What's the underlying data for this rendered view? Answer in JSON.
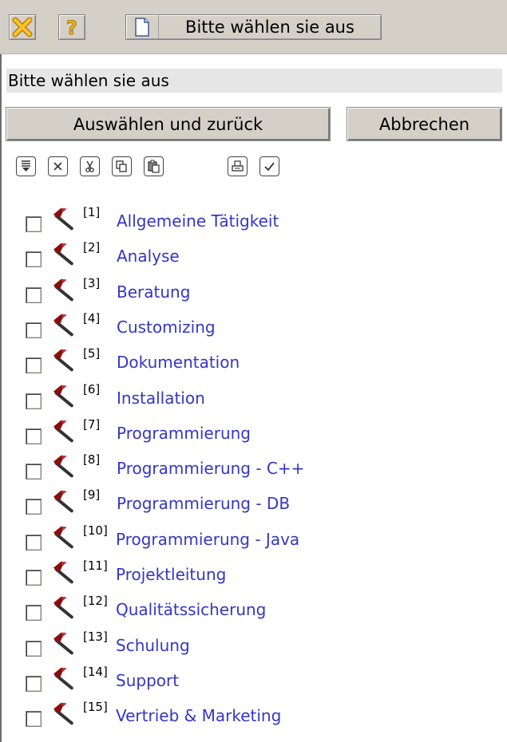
{
  "toolbar": {
    "close_icon": "close-x-icon",
    "help_icon": "question-mark-icon",
    "doc_icon": "document-icon",
    "doc_button_label": "Bitte wählen sie aus"
  },
  "title": "Bitte wählen sie aus",
  "buttons": {
    "select_label": "Auswählen und zurück",
    "cancel_label": "Abbrechen"
  },
  "iconbar": [
    "expand-list-icon",
    "delete-icon",
    "cut-icon",
    "copy-icon",
    "paste-icon",
    "print-icon",
    "check-icon"
  ],
  "list": [
    {
      "num": "[1]",
      "label": "Allgemeine Tätigkeit"
    },
    {
      "num": "[2]",
      "label": "Analyse"
    },
    {
      "num": "[3]",
      "label": "Beratung"
    },
    {
      "num": "[4]",
      "label": "Customizing"
    },
    {
      "num": "[5]",
      "label": "Dokumentation"
    },
    {
      "num": "[6]",
      "label": "Installation"
    },
    {
      "num": "[7]",
      "label": "Programmierung"
    },
    {
      "num": "[8]",
      "label": "Programmierung - C++"
    },
    {
      "num": "[9]",
      "label": "Programmierung - DB"
    },
    {
      "num": "[10]",
      "label": "Programmierung - Java"
    },
    {
      "num": "[11]",
      "label": "Projektleitung"
    },
    {
      "num": "[12]",
      "label": "Qualitätssicherung"
    },
    {
      "num": "[13]",
      "label": "Schulung"
    },
    {
      "num": "[14]",
      "label": "Support"
    },
    {
      "num": "[15]",
      "label": "Vertrieb & Marketing"
    }
  ],
  "colors": {
    "link": "#3535c8",
    "toolbar_bg": "#d4d0c8",
    "hammer_head": "#8a0e10",
    "hammer_handle": "#333333",
    "close_icon": "#f0a020"
  }
}
